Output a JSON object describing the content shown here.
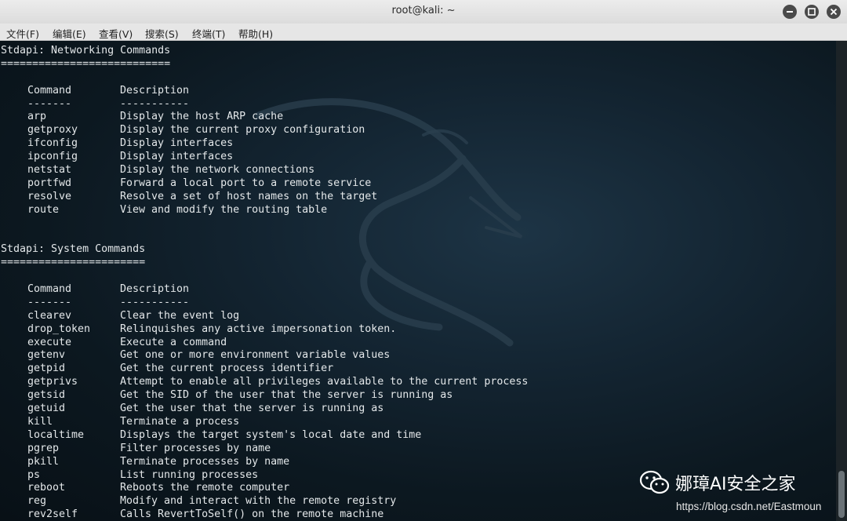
{
  "window": {
    "title": "root@kali: ~"
  },
  "menubar": [
    "文件(F)",
    "编辑(E)",
    "查看(V)",
    "搜索(S)",
    "终端(T)",
    "帮助(H)"
  ],
  "sections": [
    {
      "heading": "Stdapi: Networking Commands",
      "underline": "===========================",
      "col_command": "Command",
      "col_description": "Description",
      "col_command_rule": "-------",
      "col_description_rule": "-----------",
      "rows": [
        {
          "command": "arp",
          "description": "Display the host ARP cache"
        },
        {
          "command": "getproxy",
          "description": "Display the current proxy configuration"
        },
        {
          "command": "ifconfig",
          "description": "Display interfaces"
        },
        {
          "command": "ipconfig",
          "description": "Display interfaces"
        },
        {
          "command": "netstat",
          "description": "Display the network connections"
        },
        {
          "command": "portfwd",
          "description": "Forward a local port to a remote service"
        },
        {
          "command": "resolve",
          "description": "Resolve a set of host names on the target"
        },
        {
          "command": "route",
          "description": "View and modify the routing table"
        }
      ]
    },
    {
      "heading": "Stdapi: System Commands",
      "underline": "=======================",
      "col_command": "Command",
      "col_description": "Description",
      "col_command_rule": "-------",
      "col_description_rule": "-----------",
      "rows": [
        {
          "command": "clearev",
          "description": "Clear the event log"
        },
        {
          "command": "drop_token",
          "description": "Relinquishes any active impersonation token."
        },
        {
          "command": "execute",
          "description": "Execute a command"
        },
        {
          "command": "getenv",
          "description": "Get one or more environment variable values"
        },
        {
          "command": "getpid",
          "description": "Get the current process identifier"
        },
        {
          "command": "getprivs",
          "description": "Attempt to enable all privileges available to the current process"
        },
        {
          "command": "getsid",
          "description": "Get the SID of the user that the server is running as"
        },
        {
          "command": "getuid",
          "description": "Get the user that the server is running as"
        },
        {
          "command": "kill",
          "description": "Terminate a process"
        },
        {
          "command": "localtime",
          "description": "Displays the target system's local date and time"
        },
        {
          "command": "pgrep",
          "description": "Filter processes by name"
        },
        {
          "command": "pkill",
          "description": "Terminate processes by name"
        },
        {
          "command": "ps",
          "description": "List running processes"
        },
        {
          "command": "reboot",
          "description": "Reboots the remote computer"
        },
        {
          "command": "reg",
          "description": "Modify and interact with the remote registry"
        },
        {
          "command": "rev2self",
          "description": "Calls RevertToSelf() on the remote machine"
        }
      ]
    }
  ],
  "watermark": {
    "text": "娜璋AI安全之家",
    "url": "https://blog.csdn.net/Eastmoun",
    "icon": "wechat-icon"
  },
  "colors": {
    "terminal_text": "#e4e8ea",
    "terminal_bg": "#0f1d27"
  }
}
